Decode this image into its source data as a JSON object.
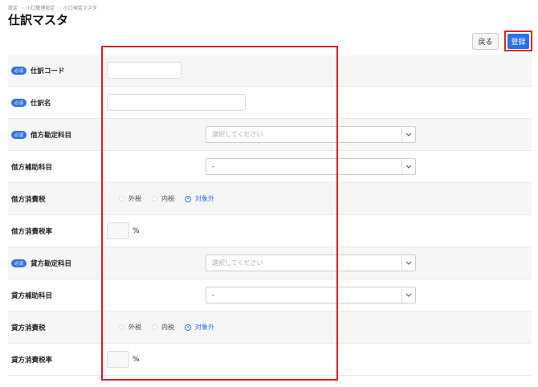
{
  "breadcrumb": [
    "設定",
    "小口管理設定",
    "小口現金マスタ"
  ],
  "page_title": "仕訳マスタ",
  "buttons": {
    "back": "戻る",
    "register": "登録"
  },
  "required_badge": "必須",
  "rows": {
    "code": {
      "label": "仕訳コード",
      "value": ""
    },
    "name": {
      "label": "仕訳名",
      "value": ""
    },
    "debit_account": {
      "label": "借方勘定科目",
      "placeholder": "選択してください"
    },
    "debit_sub": {
      "label": "借方補助科目",
      "value": "-"
    },
    "debit_tax": {
      "label": "借方消費税",
      "options": [
        "外税",
        "内税",
        "対象外"
      ],
      "selected": "対象外"
    },
    "debit_rate": {
      "label": "借方消費税率",
      "unit": "%"
    },
    "credit_account": {
      "label": "貸方勘定科目",
      "placeholder": "選択してください"
    },
    "credit_sub": {
      "label": "貸方補助科目",
      "value": "-"
    },
    "credit_tax": {
      "label": "貸方消費税",
      "options": [
        "外税",
        "内税",
        "対象外"
      ],
      "selected": "対象外"
    },
    "credit_rate": {
      "label": "貸方消費税率",
      "unit": "%"
    }
  },
  "icons": {
    "dropdown": "chevron-down-icon",
    "breadcrumb_separator": "chevron-right-icon"
  },
  "colors": {
    "primary": "#2d6fe4",
    "highlight": "#e02020"
  }
}
